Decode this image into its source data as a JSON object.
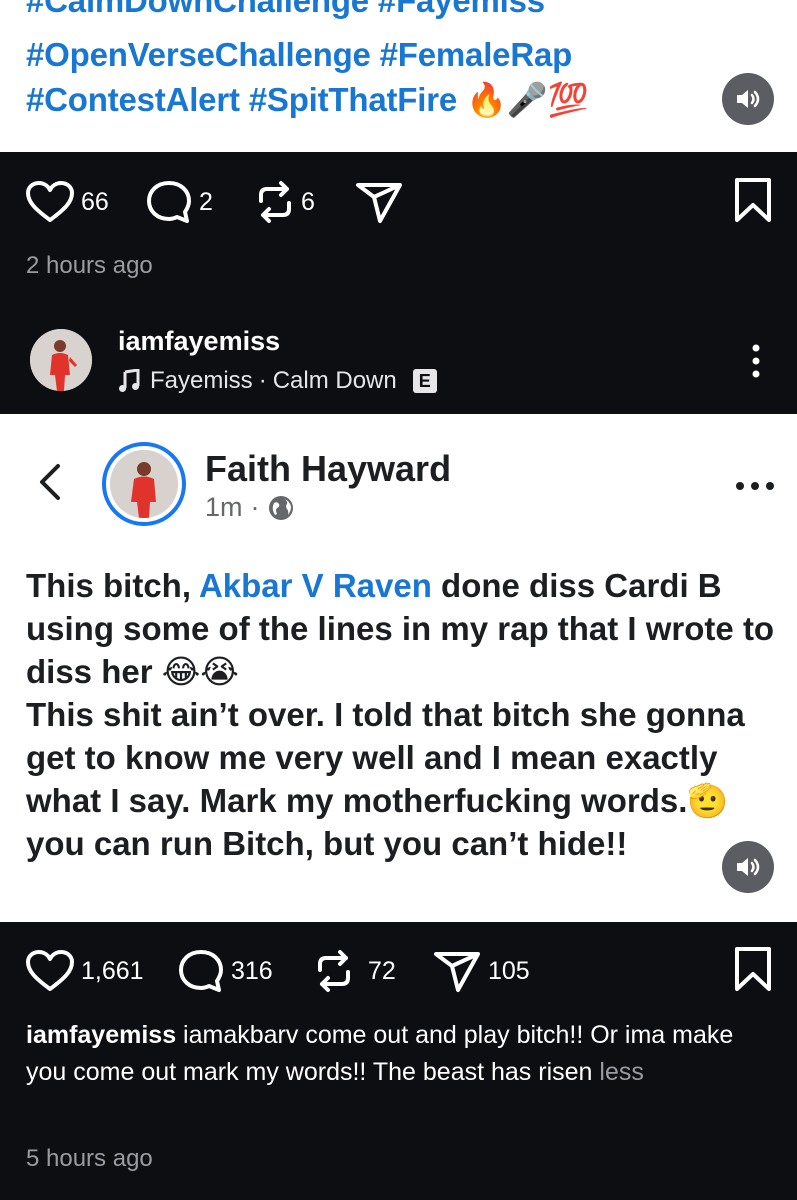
{
  "post1": {
    "hashtags_line0": "#CalmDownChallenge #Fayemiss",
    "hashtags_line1": "#OpenVerseChallenge #FemaleRap",
    "hashtags_line2": "#ContestAlert #SpitThatFire",
    "hashtags_emojis": "🔥🎤💯",
    "likes": "66",
    "comments": "2",
    "reposts": "6",
    "time": "2 hours ago"
  },
  "post2": {
    "username": "iamfayemiss",
    "audio_artist": "Fayemiss",
    "audio_separator": "·",
    "audio_title": "Calm Down",
    "explicit_badge": "E",
    "screenshot": {
      "name": "Faith Hayward",
      "time": "1m",
      "meta_separator": "·",
      "text_1_start": "This bitch, ",
      "text_1_tag": "Akbar V Raven",
      "text_1_end": " done diss Cardi B using some of the lines in my rap that I wrote to diss her 😂😭",
      "text_2": "This shit ain’t over. I told that bitch she gonna get to know me very well and I mean exactly what I say. Mark my motherfucking words.🫡 you can run Bitch, but you can’t hide!!"
    },
    "likes": "1,661",
    "comments": "316",
    "reposts": "72",
    "shares": "105",
    "caption_user": "iamfayemiss",
    "caption_text": " iamakbarv come out and play bitch!! Or ima make you come out mark my words!! The beast has risen ",
    "caption_less": "less",
    "time": "5 hours ago"
  },
  "icons": [
    "heart-icon",
    "comment-icon",
    "repost-icon",
    "share-icon",
    "bookmark-icon",
    "sound-icon",
    "music-note-icon",
    "more-icon",
    "back-icon",
    "globe-icon"
  ],
  "colors": {
    "background": "#0d0e12",
    "link": "#1877d2",
    "muted": "#9a9ca2"
  }
}
